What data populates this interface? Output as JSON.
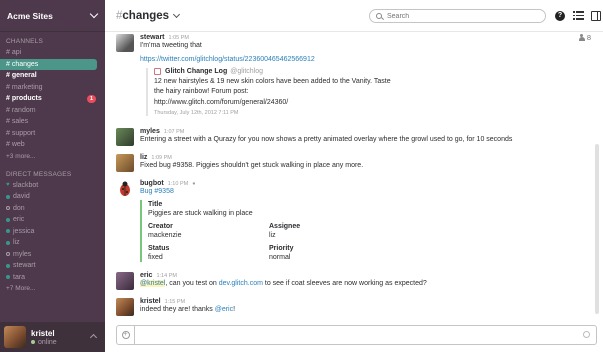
{
  "team": {
    "name": "Acme Sites"
  },
  "sidebar": {
    "channels_header": "CHANNELS",
    "channels": [
      {
        "label": "# api",
        "state": "normal"
      },
      {
        "label": "# changes",
        "state": "active"
      },
      {
        "label": "# general",
        "state": "unread"
      },
      {
        "label": "# marketing",
        "state": "normal"
      },
      {
        "label": "# products",
        "state": "unread",
        "badge": "1"
      },
      {
        "label": "# random",
        "state": "normal"
      },
      {
        "label": "# sales",
        "state": "normal"
      },
      {
        "label": "# support",
        "state": "normal"
      },
      {
        "label": "# web",
        "state": "normal"
      }
    ],
    "channels_more": "+3 more...",
    "dm_header": "DIRECT MESSAGES",
    "dms": [
      {
        "label": "slackbot",
        "status": "bot"
      },
      {
        "label": "david",
        "status": "online"
      },
      {
        "label": "don",
        "status": "away"
      },
      {
        "label": "eric",
        "status": "online"
      },
      {
        "label": "jessica",
        "status": "online"
      },
      {
        "label": "liz",
        "status": "online"
      },
      {
        "label": "myles",
        "status": "away"
      },
      {
        "label": "stewart",
        "status": "online"
      },
      {
        "label": "tara",
        "status": "online"
      }
    ],
    "dm_more": "+7 More...",
    "user": {
      "name": "kristel",
      "status": "online"
    }
  },
  "header": {
    "channel": "changes",
    "search_placeholder": "Search",
    "help": "?",
    "member_count": "8"
  },
  "colors": {
    "sidebar_bg": "#4d394b",
    "active_channel": "#4c9689",
    "badge": "#eb4d5c",
    "link": "#2a80b9",
    "bug_card_border": "#78c57c"
  },
  "messages": {
    "m1": {
      "name": "stewart",
      "time": "1:05 PM",
      "text": "I'm'ma tweeting that",
      "link": "https://twitter.com/glitchlog/status/223600465462566912",
      "att_title": "Glitch Change Log",
      "att_handle": "@glitchlog",
      "att_text1": "12 new hairstyles & 19 new skin colors have been added to the Vanity. Taste",
      "att_text2": "the hairy rainbow! Forum post:",
      "att_link": "http://www.glitch.com/forum/general/24360/",
      "att_foot": "Thursday, July 12th, 2012 7:11 PM"
    },
    "m2": {
      "name": "myles",
      "time": "1:07 PM",
      "text": "Entering a street with a Qurazy for you now shows a pretty animated overlay where the growl used to go, for 10 seconds"
    },
    "m3": {
      "name": "liz",
      "time": "1:09 PM",
      "text": "Fixed bug #9358. Piggies shouldn't get stuck walking in place any more."
    },
    "m4": {
      "name": "bugbot",
      "time": "1:10 PM",
      "badge": "●",
      "link": "Bug #9358",
      "title_label": "Title",
      "title_value": "Piggies are stuck walking in place",
      "creator_label": "Creator",
      "creator_value": "mackenzie",
      "assignee_label": "Assignee",
      "assignee_value": "liz",
      "status_label": "Status",
      "status_value": "fixed",
      "priority_label": "Priority",
      "priority_value": "normal"
    },
    "m5": {
      "name": "eric",
      "time": "1:14 PM",
      "mention": "@kristel",
      "text_a": ", can you test on ",
      "link": "dev.glitch.com",
      "text_b": " to see if coat sleeves are now working as expected?"
    },
    "m6": {
      "name": "kristel",
      "time": "1:15 PM",
      "text_a": "indeed they are! thanks ",
      "mention": "@eric",
      "text_b": "!"
    }
  },
  "composer": {
    "placeholder": "",
    "plus": "+"
  }
}
